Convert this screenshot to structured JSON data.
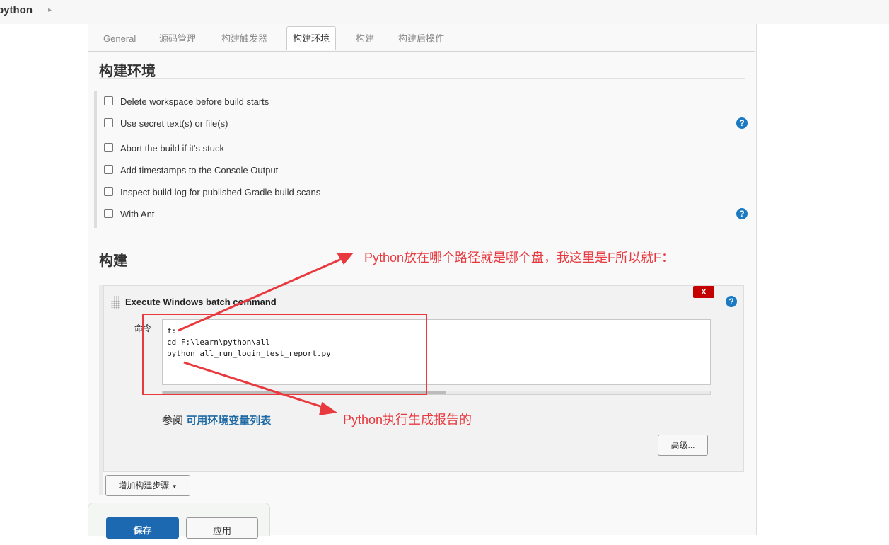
{
  "breadcrumb": {
    "project": "python"
  },
  "tabs": [
    {
      "label": "General",
      "active": false
    },
    {
      "label": "源码管理",
      "active": false
    },
    {
      "label": "构建触发器",
      "active": false
    },
    {
      "label": "构建环境",
      "active": true
    },
    {
      "label": "构建",
      "active": false
    },
    {
      "label": "构建后操作",
      "active": false
    }
  ],
  "build_env": {
    "title": "构建环境",
    "options": [
      {
        "label": "Delete workspace before build starts",
        "checked": false
      },
      {
        "label": "Use secret text(s) or file(s)",
        "checked": false
      },
      {
        "label": "Abort the build if it's stuck",
        "checked": false
      },
      {
        "label": "Add timestamps to the Console Output",
        "checked": false
      },
      {
        "label": "Inspect build log for published Gradle build scans",
        "checked": false
      },
      {
        "label": "With Ant",
        "checked": false
      }
    ]
  },
  "build": {
    "title": "构建",
    "step_title": "Execute Windows batch command",
    "delete_label": "x",
    "command_label": "命令",
    "command_text": "f:\ncd F:\\learn\\python\\all\npython all_run_login_test_report.py",
    "ref_prefix": "参阅",
    "ref_link": "可用环境变量列表",
    "advanced_button": "高级...",
    "add_step_button": "增加构建步骤"
  },
  "footer": {
    "save_button": "保存",
    "apply_button": "应用"
  },
  "annotations": {
    "top": "Python放在哪个路径就是哪个盘，我这里是F所以就F：",
    "bottom": "Python执行生成报告的",
    "color": "#e8393f"
  },
  "help_icon": "?",
  "colors": {
    "link": "#1f6aa5",
    "primary_button": "#1d69b1",
    "delete_button": "#c40000",
    "help_icon": "#1b7ac2"
  }
}
